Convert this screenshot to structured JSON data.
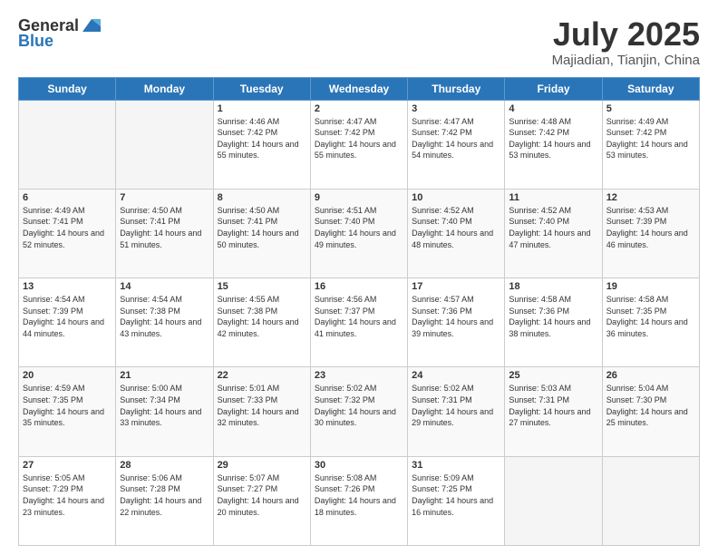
{
  "header": {
    "logo_general": "General",
    "logo_blue": "Blue",
    "title": "July 2025",
    "location": "Majiadian, Tianjin, China"
  },
  "weekdays": [
    "Sunday",
    "Monday",
    "Tuesday",
    "Wednesday",
    "Thursday",
    "Friday",
    "Saturday"
  ],
  "weeks": [
    [
      {
        "day": "",
        "sunrise": "",
        "sunset": "",
        "daylight": ""
      },
      {
        "day": "",
        "sunrise": "",
        "sunset": "",
        "daylight": ""
      },
      {
        "day": "1",
        "sunrise": "Sunrise: 4:46 AM",
        "sunset": "Sunset: 7:42 PM",
        "daylight": "Daylight: 14 hours and 55 minutes."
      },
      {
        "day": "2",
        "sunrise": "Sunrise: 4:47 AM",
        "sunset": "Sunset: 7:42 PM",
        "daylight": "Daylight: 14 hours and 55 minutes."
      },
      {
        "day": "3",
        "sunrise": "Sunrise: 4:47 AM",
        "sunset": "Sunset: 7:42 PM",
        "daylight": "Daylight: 14 hours and 54 minutes."
      },
      {
        "day": "4",
        "sunrise": "Sunrise: 4:48 AM",
        "sunset": "Sunset: 7:42 PM",
        "daylight": "Daylight: 14 hours and 53 minutes."
      },
      {
        "day": "5",
        "sunrise": "Sunrise: 4:49 AM",
        "sunset": "Sunset: 7:42 PM",
        "daylight": "Daylight: 14 hours and 53 minutes."
      }
    ],
    [
      {
        "day": "6",
        "sunrise": "Sunrise: 4:49 AM",
        "sunset": "Sunset: 7:41 PM",
        "daylight": "Daylight: 14 hours and 52 minutes."
      },
      {
        "day": "7",
        "sunrise": "Sunrise: 4:50 AM",
        "sunset": "Sunset: 7:41 PM",
        "daylight": "Daylight: 14 hours and 51 minutes."
      },
      {
        "day": "8",
        "sunrise": "Sunrise: 4:50 AM",
        "sunset": "Sunset: 7:41 PM",
        "daylight": "Daylight: 14 hours and 50 minutes."
      },
      {
        "day": "9",
        "sunrise": "Sunrise: 4:51 AM",
        "sunset": "Sunset: 7:40 PM",
        "daylight": "Daylight: 14 hours and 49 minutes."
      },
      {
        "day": "10",
        "sunrise": "Sunrise: 4:52 AM",
        "sunset": "Sunset: 7:40 PM",
        "daylight": "Daylight: 14 hours and 48 minutes."
      },
      {
        "day": "11",
        "sunrise": "Sunrise: 4:52 AM",
        "sunset": "Sunset: 7:40 PM",
        "daylight": "Daylight: 14 hours and 47 minutes."
      },
      {
        "day": "12",
        "sunrise": "Sunrise: 4:53 AM",
        "sunset": "Sunset: 7:39 PM",
        "daylight": "Daylight: 14 hours and 46 minutes."
      }
    ],
    [
      {
        "day": "13",
        "sunrise": "Sunrise: 4:54 AM",
        "sunset": "Sunset: 7:39 PM",
        "daylight": "Daylight: 14 hours and 44 minutes."
      },
      {
        "day": "14",
        "sunrise": "Sunrise: 4:54 AM",
        "sunset": "Sunset: 7:38 PM",
        "daylight": "Daylight: 14 hours and 43 minutes."
      },
      {
        "day": "15",
        "sunrise": "Sunrise: 4:55 AM",
        "sunset": "Sunset: 7:38 PM",
        "daylight": "Daylight: 14 hours and 42 minutes."
      },
      {
        "day": "16",
        "sunrise": "Sunrise: 4:56 AM",
        "sunset": "Sunset: 7:37 PM",
        "daylight": "Daylight: 14 hours and 41 minutes."
      },
      {
        "day": "17",
        "sunrise": "Sunrise: 4:57 AM",
        "sunset": "Sunset: 7:36 PM",
        "daylight": "Daylight: 14 hours and 39 minutes."
      },
      {
        "day": "18",
        "sunrise": "Sunrise: 4:58 AM",
        "sunset": "Sunset: 7:36 PM",
        "daylight": "Daylight: 14 hours and 38 minutes."
      },
      {
        "day": "19",
        "sunrise": "Sunrise: 4:58 AM",
        "sunset": "Sunset: 7:35 PM",
        "daylight": "Daylight: 14 hours and 36 minutes."
      }
    ],
    [
      {
        "day": "20",
        "sunrise": "Sunrise: 4:59 AM",
        "sunset": "Sunset: 7:35 PM",
        "daylight": "Daylight: 14 hours and 35 minutes."
      },
      {
        "day": "21",
        "sunrise": "Sunrise: 5:00 AM",
        "sunset": "Sunset: 7:34 PM",
        "daylight": "Daylight: 14 hours and 33 minutes."
      },
      {
        "day": "22",
        "sunrise": "Sunrise: 5:01 AM",
        "sunset": "Sunset: 7:33 PM",
        "daylight": "Daylight: 14 hours and 32 minutes."
      },
      {
        "day": "23",
        "sunrise": "Sunrise: 5:02 AM",
        "sunset": "Sunset: 7:32 PM",
        "daylight": "Daylight: 14 hours and 30 minutes."
      },
      {
        "day": "24",
        "sunrise": "Sunrise: 5:02 AM",
        "sunset": "Sunset: 7:31 PM",
        "daylight": "Daylight: 14 hours and 29 minutes."
      },
      {
        "day": "25",
        "sunrise": "Sunrise: 5:03 AM",
        "sunset": "Sunset: 7:31 PM",
        "daylight": "Daylight: 14 hours and 27 minutes."
      },
      {
        "day": "26",
        "sunrise": "Sunrise: 5:04 AM",
        "sunset": "Sunset: 7:30 PM",
        "daylight": "Daylight: 14 hours and 25 minutes."
      }
    ],
    [
      {
        "day": "27",
        "sunrise": "Sunrise: 5:05 AM",
        "sunset": "Sunset: 7:29 PM",
        "daylight": "Daylight: 14 hours and 23 minutes."
      },
      {
        "day": "28",
        "sunrise": "Sunrise: 5:06 AM",
        "sunset": "Sunset: 7:28 PM",
        "daylight": "Daylight: 14 hours and 22 minutes."
      },
      {
        "day": "29",
        "sunrise": "Sunrise: 5:07 AM",
        "sunset": "Sunset: 7:27 PM",
        "daylight": "Daylight: 14 hours and 20 minutes."
      },
      {
        "day": "30",
        "sunrise": "Sunrise: 5:08 AM",
        "sunset": "Sunset: 7:26 PM",
        "daylight": "Daylight: 14 hours and 18 minutes."
      },
      {
        "day": "31",
        "sunrise": "Sunrise: 5:09 AM",
        "sunset": "Sunset: 7:25 PM",
        "daylight": "Daylight: 14 hours and 16 minutes."
      },
      {
        "day": "",
        "sunrise": "",
        "sunset": "",
        "daylight": ""
      },
      {
        "day": "",
        "sunrise": "",
        "sunset": "",
        "daylight": ""
      }
    ]
  ]
}
